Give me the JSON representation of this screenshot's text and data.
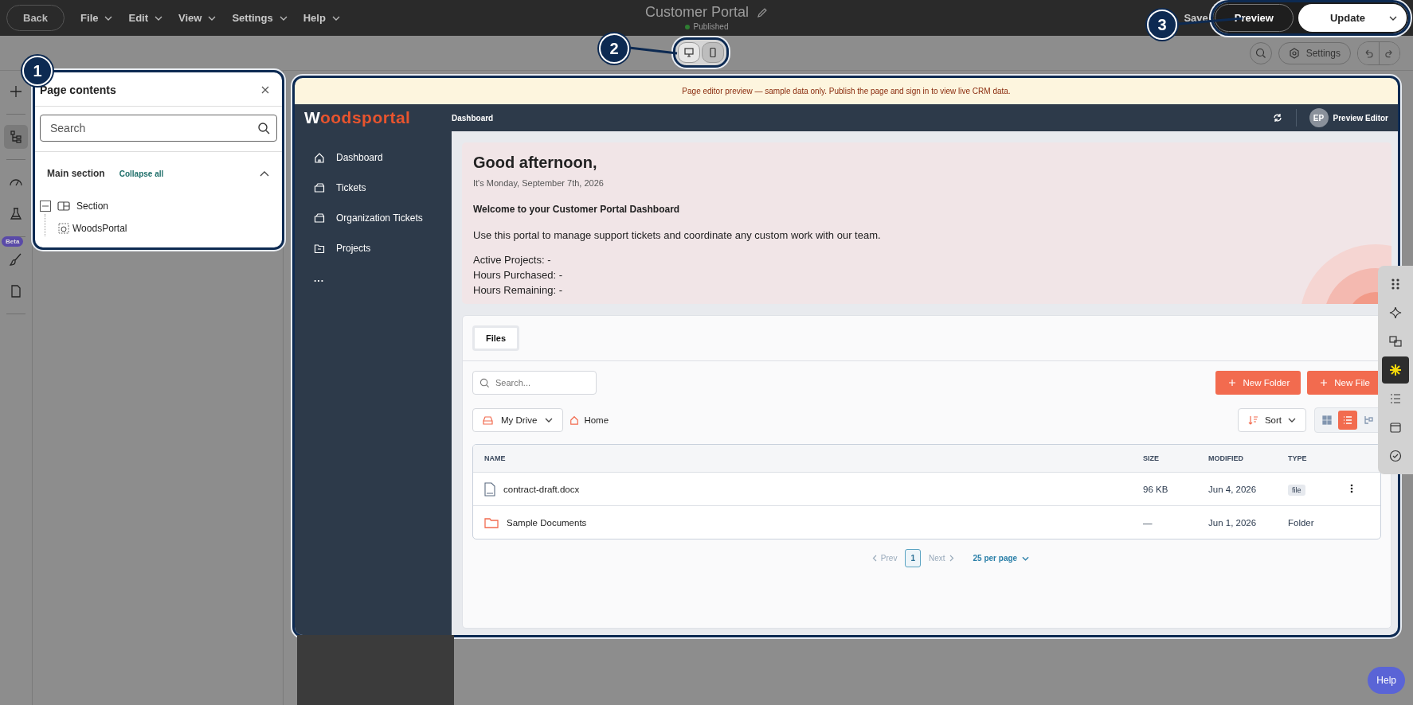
{
  "topbar": {
    "back": "Back",
    "menus": [
      {
        "label": "File"
      },
      {
        "label": "Edit"
      },
      {
        "label": "View"
      },
      {
        "label": "Settings"
      },
      {
        "label": "Help"
      }
    ],
    "title": "Customer Portal",
    "status": "Published",
    "save": "Save",
    "preview": "Preview",
    "update": "Update"
  },
  "toolbar": {
    "devices": [
      {
        "kind": "desktop",
        "selected": true
      },
      {
        "kind": "mobile",
        "selected": false
      }
    ],
    "settings": "Settings"
  },
  "rail": [
    {
      "kind": "add",
      "selected": false
    },
    {
      "kind": "tree",
      "selected": true
    },
    {
      "kind": "gauge",
      "selected": false
    },
    {
      "kind": "flask",
      "selected": false
    },
    {
      "kind": "brush",
      "selected": false,
      "badge": "Beta"
    },
    {
      "kind": "page",
      "selected": false
    }
  ],
  "page_contents": {
    "title": "Page contents",
    "search_placeholder": "Search",
    "section_title": "Main section",
    "collapse": "Collapse all",
    "expanded": true,
    "tree": [
      {
        "label": "Section",
        "expanded": true,
        "children": [
          {
            "label": "WoodsPortal"
          }
        ]
      }
    ]
  },
  "preview": {
    "banner": "Page editor preview — sample data only. Publish the page and sign in to view live CRM data.",
    "logo": "Woodsportal",
    "breadcrumb": "Dashboard",
    "user": {
      "initials": "EP",
      "name": "Preview Editor"
    },
    "nav": [
      {
        "kind": "home",
        "label": "Dashboard"
      },
      {
        "kind": "ticket",
        "label": "Tickets"
      },
      {
        "kind": "ticket",
        "label": "Organization Tickets"
      },
      {
        "kind": "project",
        "label": "Projects"
      },
      {
        "kind": "more",
        "label": "..."
      }
    ],
    "greeting": {
      "title": "Good afternoon,",
      "date": "It's Monday, September 7th, 2026",
      "heading": "Welcome to your Customer Portal Dashboard",
      "body": "Use this portal to manage support tickets and coordinate any custom work with our team.",
      "stats": [
        "Active Projects: -",
        "Hours Purchased: -",
        "Hours Remaining: -"
      ]
    },
    "files": {
      "tabs": [
        {
          "label": "Files",
          "selected": true
        }
      ],
      "search_placeholder": "Search...",
      "new_folder": "New Folder",
      "new_file": "New File",
      "drive": "My Drive",
      "crumb": "Home",
      "sort": "Sort",
      "views": [
        {
          "kind": "grid",
          "selected": false
        },
        {
          "kind": "list",
          "selected": true
        },
        {
          "kind": "tree",
          "selected": false
        }
      ],
      "columns": [
        "NAME",
        "SIZE",
        "MODIFIED",
        "TYPE"
      ],
      "rows": [
        {
          "kind": "file",
          "name": "contract-draft.docx",
          "size": "96 KB",
          "modified": "Jun 4, 2026",
          "type": "file"
        },
        {
          "kind": "folder",
          "name": "Sample Documents",
          "size": "—",
          "modified": "Jun 1, 2026",
          "type": "Folder"
        }
      ],
      "pagination": {
        "prev": "Prev",
        "page": "1",
        "next": "Next",
        "per_page": "25 per page"
      }
    }
  },
  "right_tools": [
    {
      "kind": "drag"
    },
    {
      "kind": "sparkle"
    },
    {
      "kind": "translate"
    },
    {
      "kind": "brand"
    },
    {
      "kind": "list"
    },
    {
      "kind": "calendar"
    },
    {
      "kind": "check"
    }
  ],
  "help": "Help",
  "callouts": [
    "1",
    "2",
    "3"
  ]
}
